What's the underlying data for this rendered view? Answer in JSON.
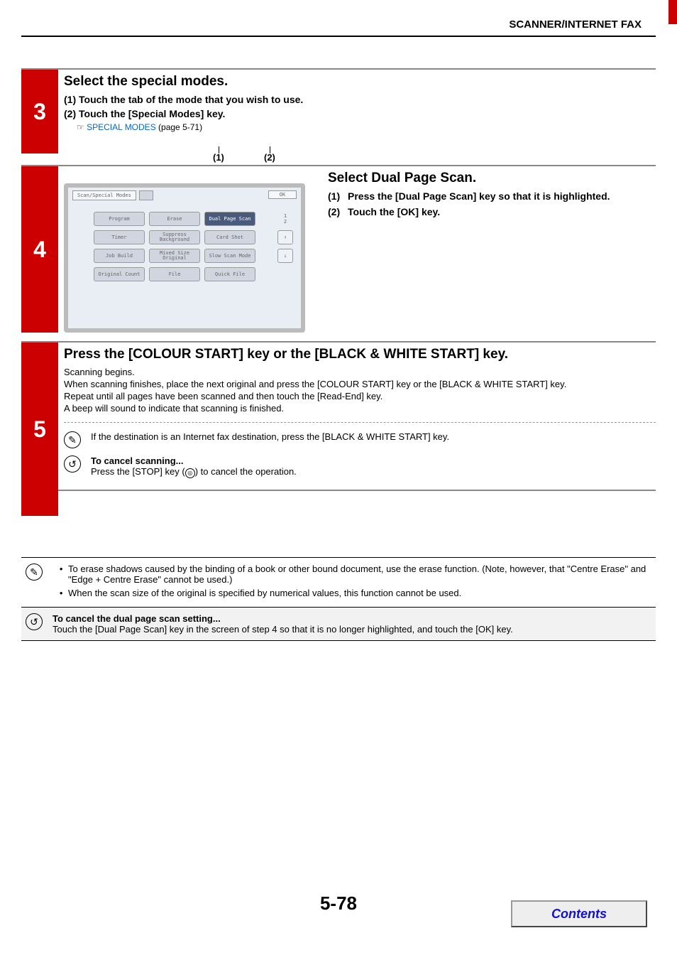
{
  "header": {
    "title": "SCANNER/INTERNET FAX"
  },
  "step3": {
    "heading": "Select the special modes.",
    "sub1": "(1)  Touch the tab of the mode that you wish to use.",
    "sub2": "(2)  Touch the [Special Modes] key.",
    "see_icon": "☞",
    "link": "SPECIAL MODES",
    "link_after": " (page 5-71)"
  },
  "step4": {
    "callout1": "(1)",
    "callout2": "(2)",
    "tab_label": "Scan/Special Modes",
    "ok": "OK",
    "modes": [
      "Program",
      "Erase",
      "Dual Page Scan",
      "Timer",
      "Suppress Background",
      "Card Shot",
      "Job Build",
      "Mixed Size Original",
      "Slow Scan Mode",
      "Original Count",
      "File",
      "Quick File"
    ],
    "page_ind": "1\n2",
    "arrow_up": "↑",
    "arrow_dn": "↓",
    "right_heading": "Select Dual Page Scan.",
    "right_sub1_num": "(1)",
    "right_sub1_txt": "Press the [Dual Page Scan] key so that it is highlighted.",
    "right_sub2_num": "(2)",
    "right_sub2_txt": "Touch the [OK] key."
  },
  "step5": {
    "heading": "Press the [COLOUR START] key or the [BLACK & WHITE START] key.",
    "b1": "Scanning begins.",
    "b2": "When scanning finishes, place the next original and press the [COLOUR START] key or the [BLACK & WHITE START] key.",
    "b3": "Repeat until all pages have been scanned and then touch the [Read-End] key.",
    "b4": "A beep will sound to indicate that scanning is finished.",
    "note1": "If the destination is an Internet fax destination, press the [BLACK & WHITE START] key.",
    "note2_title": "To cancel scanning...",
    "note2_body_a": "Press the [STOP] key (",
    "note2_body_b": ") to cancel the operation.",
    "stop_glyph": "◎"
  },
  "bottom": {
    "n1a": "To erase shadows caused by the binding of a book or other bound document, use the erase function. (Note, however, that \"Centre Erase\" and \"Edge + Centre Erase\" cannot be used.)",
    "n1b": "When the scan size of the original is specified by numerical values, this function cannot be used.",
    "n2_title": "To cancel the dual page scan setting...",
    "n2_body": "Touch the [Dual Page Scan] key in the screen of step 4 so that it is no longer highlighted, and touch the [OK] key."
  },
  "footer": {
    "page": "5-78",
    "contents": "Contents"
  },
  "icons": {
    "pencil": "✎",
    "undo": "↺"
  }
}
